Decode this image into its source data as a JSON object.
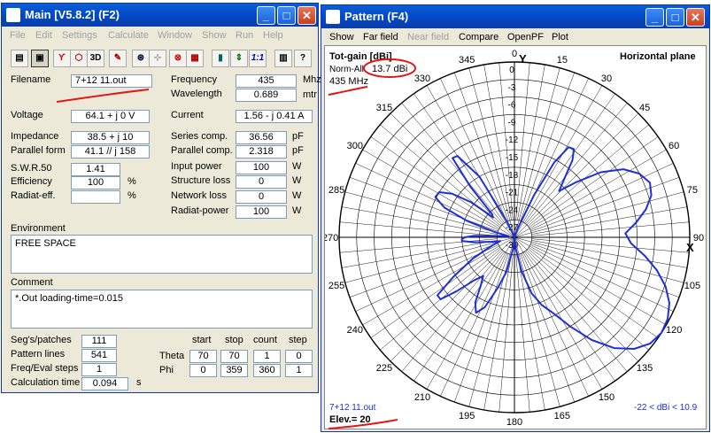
{
  "main": {
    "title": "Main [V5.8.2]  (F2)",
    "menu": [
      {
        "label": "File",
        "disabled": true
      },
      {
        "label": "Edit",
        "disabled": true
      },
      {
        "label": "Settings",
        "disabled": true
      },
      {
        "label": "Calculate",
        "disabled": true
      },
      {
        "label": "Window",
        "disabled": true
      },
      {
        "label": "Show",
        "disabled": true
      },
      {
        "label": "Run",
        "disabled": true
      },
      {
        "label": "Help",
        "disabled": true
      }
    ],
    "toolbar": {
      "icons": [
        "open-file-icon",
        "save-icon",
        "antenna-icon",
        "geometry-icon",
        "3d-view-icon",
        "edit-icon",
        "source-icon",
        "ground-icon",
        "load-icon",
        "table-icon",
        "sweep-icon",
        "ratio-icon",
        "notepad-icon",
        "help-icon"
      ],
      "text_3d": "3D",
      "text_ratio": "1:1",
      "text_help": "?"
    },
    "filename_label": "Filename",
    "filename": "7+12 11.out",
    "frequency_label": "Frequency",
    "frequency": "435",
    "frequency_unit": "Mhz",
    "wavelength_label": "Wavelength",
    "wavelength": "0.689",
    "wavelength_unit": "mtr",
    "voltage_label": "Voltage",
    "voltage": "64.1 + j 0 V",
    "current_label": "Current",
    "current": "1.56 - j 0.41 A",
    "impedance_label": "Impedance",
    "impedance": "38.5 + j 10",
    "parallel_label": "Parallel form",
    "parallel": "41.1 // j 158",
    "series_comp_label": "Series comp.",
    "series_comp": "36.56",
    "series_comp_unit": "pF",
    "parallel_comp_label": "Parallel comp.",
    "parallel_comp": "2.318",
    "parallel_comp_unit": "pF",
    "swr_label": "S.W.R.50",
    "swr": "1.41",
    "efficiency_label": "Efficiency",
    "efficiency": "100",
    "efficiency_unit": "%",
    "radiat_eff_label": "Radiat-eff.",
    "radiat_eff": "",
    "radiat_eff_unit": "%",
    "input_power_label": "Input power",
    "input_power": "100",
    "input_power_unit": "W",
    "structure_loss_label": "Structure loss",
    "structure_loss": "0",
    "structure_loss_unit": "W",
    "network_loss_label": "Network loss",
    "network_loss": "0",
    "network_loss_unit": "W",
    "radiat_power_label": "Radiat-power",
    "radiat_power": "100",
    "radiat_power_unit": "W",
    "environment_label": "Environment",
    "environment": "FREE SPACE",
    "comment_label": "Comment",
    "comment": "*.Out loading-time=0.015",
    "segs_label": "Seg's/patches",
    "segs": "111",
    "pattern_lines_label": "Pattern lines",
    "pattern_lines": "541",
    "freq_eval_label": "Freq/Eval steps",
    "freq_eval": "1",
    "calc_time_label": "Calculation time",
    "calc_time": "0.094",
    "calc_time_unit": "s",
    "headers": {
      "start": "start",
      "stop": "stop",
      "count": "count",
      "step": "step"
    },
    "theta_label": "Theta",
    "theta": {
      "start": "70",
      "stop": "70",
      "count": "1",
      "step": "0"
    },
    "phi_label": "Phi",
    "phi": {
      "start": "0",
      "stop": "359",
      "count": "360",
      "step": "1"
    }
  },
  "pattern": {
    "title": "Pattern    (F4)",
    "menu": [
      {
        "label": "Show",
        "disabled": false
      },
      {
        "label": "Far field",
        "disabled": false
      },
      {
        "label": "Near field",
        "disabled": true
      },
      {
        "label": "Compare",
        "disabled": false
      },
      {
        "label": "OpenPF",
        "disabled": false
      },
      {
        "label": "Plot",
        "disabled": false
      }
    ],
    "gain_title": "Tot-gain [dBi]",
    "norm_label": "Norm-All",
    "norm_value": "13.7 dBi",
    "freq_text": "435 MHz",
    "plane": "Horizontal plane",
    "y_axis_label": "Y",
    "x_axis_label": "X",
    "file_text": "7+12 11.out",
    "elev_text": "Elev.= 20",
    "range_text": "-22 < dBi < 10.9"
  },
  "chart_data": {
    "type": "polar",
    "title": "Tot-gain [dBi]",
    "unit": "dB below max",
    "radial_labels": [
      0,
      -3,
      -6,
      -9,
      -12,
      -15,
      -18,
      -21,
      -24,
      -27,
      -30
    ],
    "angle_labels": [
      0,
      15,
      30,
      45,
      60,
      75,
      90,
      105,
      120,
      135,
      150,
      165,
      180,
      195,
      210,
      225,
      240,
      255,
      270,
      285,
      300,
      315,
      330,
      345
    ],
    "series": [
      {
        "color": "#1f2fd8",
        "phi": [
          0,
          10,
          20,
          25,
          28,
          31,
          34,
          37,
          40,
          44,
          48,
          53,
          58,
          63,
          68,
          73,
          78,
          83,
          88,
          93,
          98,
          103,
          108,
          113,
          118,
          123,
          128,
          133,
          138,
          143,
          148,
          153,
          158,
          163,
          168,
          173,
          180,
          187,
          193,
          198,
          203,
          207,
          211,
          215,
          219,
          223,
          227,
          230,
          233,
          237,
          243,
          250,
          255,
          259,
          263,
          266,
          268,
          270,
          272,
          274,
          277,
          281,
          285,
          289,
          293,
          297,
          301,
          305,
          309,
          313,
          316,
          319,
          322,
          325,
          330,
          335,
          340,
          350
        ],
        "rel_db": [
          -30,
          -30,
          -28.5,
          -22,
          -15.5,
          -12,
          -11.8,
          -13.5,
          -16.5,
          -19,
          -16,
          -11.5,
          -8,
          -6,
          -5,
          -5.5,
          -7,
          -9,
          -11,
          -10,
          -7.5,
          -5,
          -2.8,
          -1.2,
          -0.3,
          0,
          -0.5,
          -2,
          -4.5,
          -8,
          -12,
          -15.5,
          -17.5,
          -20,
          -24,
          -28,
          -30,
          -28,
          -24,
          -21,
          -17,
          -15.5,
          -17,
          -20,
          -21.5,
          -20,
          -16.5,
          -13.5,
          -13.5,
          -17.5,
          -22,
          -26,
          -27.5,
          -26,
          -23,
          -21,
          -21,
          -21.5,
          -23,
          -26,
          -28.5,
          -29,
          -26.5,
          -21.5,
          -17,
          -14.8,
          -15,
          -17,
          -20.5,
          -25,
          -24.5,
          -18.5,
          -12.8,
          -13,
          -18,
          -27,
          -30,
          -30
        ]
      }
    ]
  }
}
